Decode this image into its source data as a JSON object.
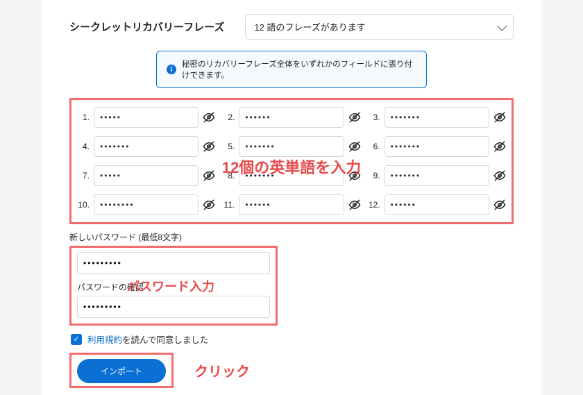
{
  "header": {
    "title": "シークレットリカバリーフレーズ",
    "phrase_count_label": "12 語のフレーズがあります"
  },
  "info_banner": "秘密のリカバリーフレーズ全体をいずれかのフィールドに張り付けできます。",
  "seed": {
    "items": [
      {
        "num": "1.",
        "mask": "•••••"
      },
      {
        "num": "2.",
        "mask": "••••••"
      },
      {
        "num": "3.",
        "mask": "•••••••"
      },
      {
        "num": "4.",
        "mask": "•••••••"
      },
      {
        "num": "5.",
        "mask": "•••••••"
      },
      {
        "num": "6.",
        "mask": "•••••••"
      },
      {
        "num": "7.",
        "mask": "•••••"
      },
      {
        "num": "8.",
        "mask": "•••••••"
      },
      {
        "num": "9.",
        "mask": "•••••••"
      },
      {
        "num": "10.",
        "mask": "••••••••"
      },
      {
        "num": "11.",
        "mask": "••••••"
      },
      {
        "num": "12.",
        "mask": "••••••"
      }
    ]
  },
  "annotations": {
    "seed_overlay": "12個の英単語を入力",
    "password_overlay": "パスワード入力",
    "click_label": "クリック"
  },
  "password": {
    "new_label": "新しいパスワード (最低8文字)",
    "confirm_label": "パスワードの確認",
    "new_mask": "•••••••••",
    "confirm_mask": "•••••••••"
  },
  "terms": {
    "link_text": "利用規約",
    "rest_text": "を読んで同意しました"
  },
  "buttons": {
    "import": "インポート"
  },
  "colors": {
    "accent": "#0b70d4",
    "annotation": "#e84a4a",
    "annotation_border": "#f26d6d"
  }
}
